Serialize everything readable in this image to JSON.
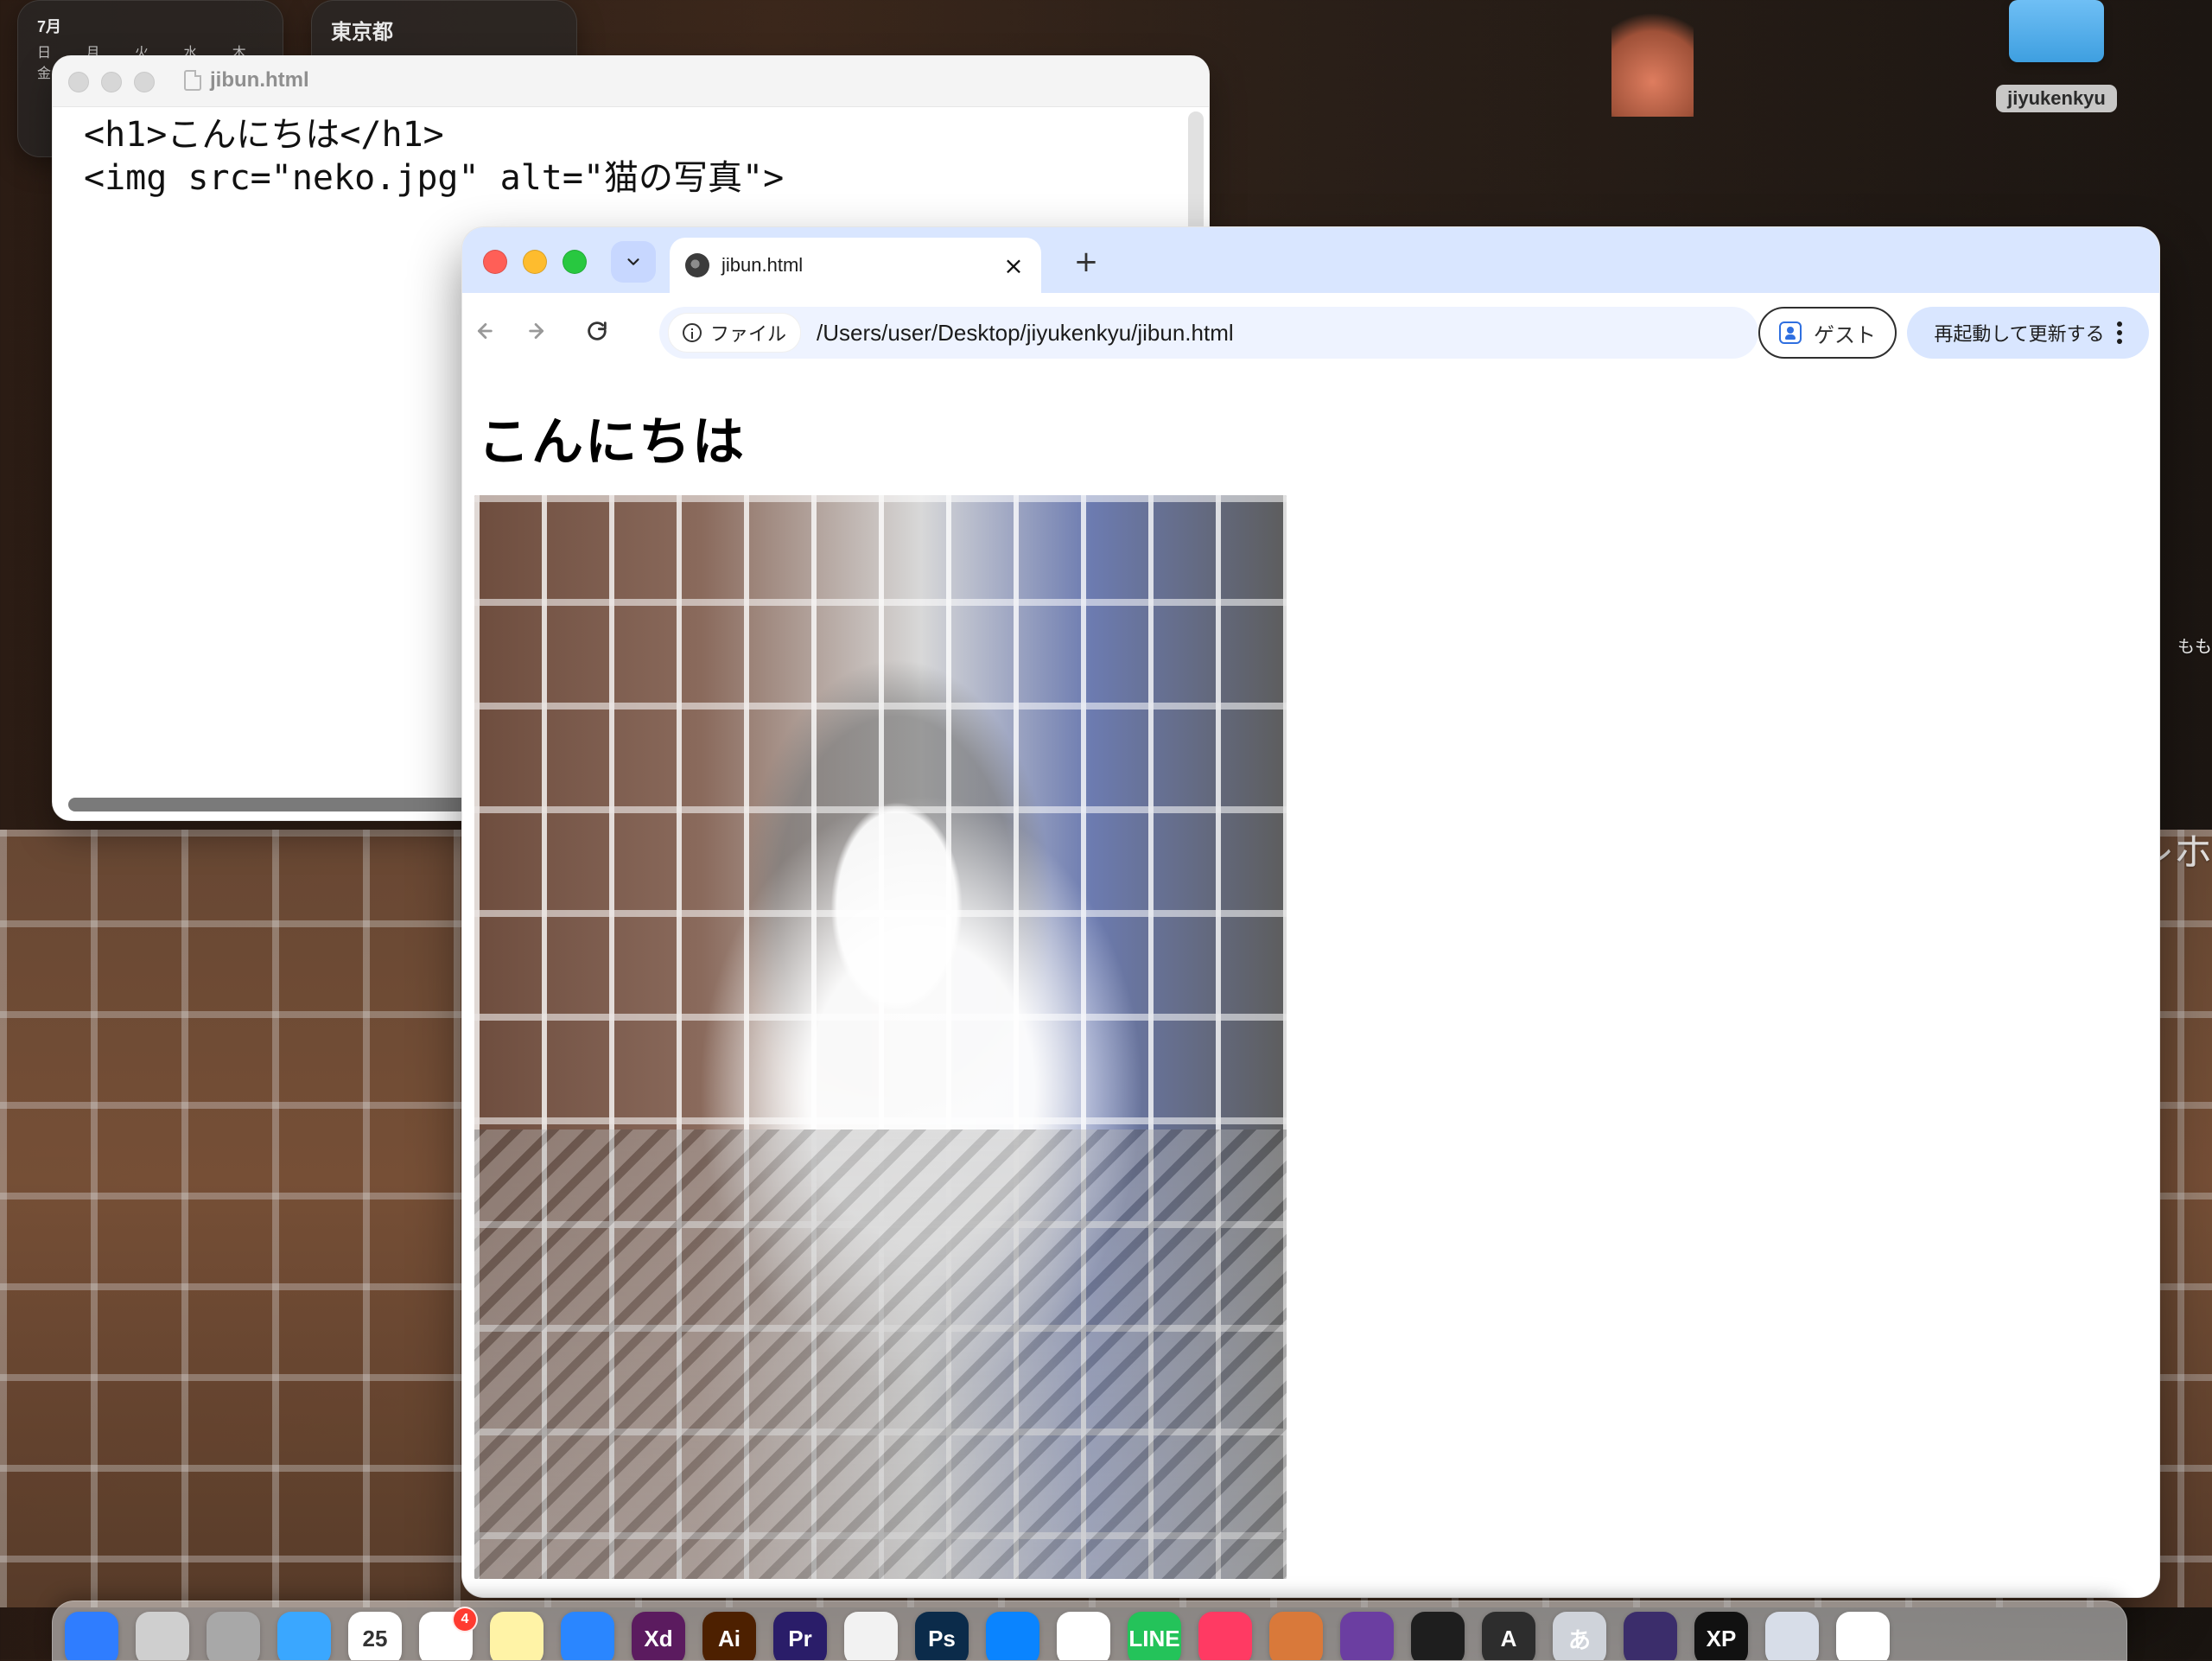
{
  "desktop": {
    "widgets": [
      {
        "title": "7月",
        "subtitle": "日 月 火 水 木 金 土"
      },
      {
        "title": "東京都",
        "subtitle": ""
      }
    ],
    "folder_label": "jiyukenkyu",
    "right_snippets": [
      "もも",
      "レホ"
    ]
  },
  "editor": {
    "title": "jibun.html",
    "lines": [
      "<h1>こんにちは</h1>",
      "<img src=\"neko.jpg\" alt=\"猫の写真\">"
    ]
  },
  "browser": {
    "tab_title": "jibun.html",
    "new_tab_symbol": "+",
    "tab_close_symbol": "×",
    "omnibox": {
      "chip_label": "ファイル",
      "url": "/Users/user/Desktop/jiyukenkyu/jibun.html"
    },
    "guest_label": "ゲスト",
    "update_label": "再起動して更新する",
    "page": {
      "h1": "こんにちは",
      "image_alt": "猫の写真"
    }
  },
  "dock": {
    "apps": [
      {
        "name": "Finder",
        "color": "#2f7dff",
        "label": ""
      },
      {
        "name": "Launchpad",
        "color": "#cfcfcf",
        "label": ""
      },
      {
        "name": "Settings",
        "color": "#a8a8a8",
        "label": ""
      },
      {
        "name": "Mail",
        "color": "#3aa7ff",
        "label": ""
      },
      {
        "name": "Calendar",
        "color": "#ffffff",
        "label": "25"
      },
      {
        "name": "Reminders",
        "color": "#ffffff",
        "label": "",
        "badge": "4"
      },
      {
        "name": "Notes",
        "color": "#fff3a6",
        "label": ""
      },
      {
        "name": "App Store",
        "color": "#2a86ff",
        "label": ""
      },
      {
        "name": "Adobe XD",
        "color": "#5b1b5f",
        "label": "Xd"
      },
      {
        "name": "Illustrator",
        "color": "#4d2000",
        "label": "Ai"
      },
      {
        "name": "Premiere",
        "color": "#2a1d69",
        "label": "Pr"
      },
      {
        "name": "Chrome",
        "color": "#f2f2f2",
        "label": ""
      },
      {
        "name": "Photoshop",
        "color": "#0b2b4a",
        "label": "Ps"
      },
      {
        "name": "VS Code",
        "color": "#0a84ff",
        "label": ""
      },
      {
        "name": "Slack",
        "color": "#ffffff",
        "label": ""
      },
      {
        "name": "LINE",
        "color": "#24c35a",
        "label": "LINE"
      },
      {
        "name": "Creative Cloud",
        "color": "#ff3a63",
        "label": ""
      },
      {
        "name": "Claude",
        "color": "#d9793a",
        "label": ""
      },
      {
        "name": "GitHub Desktop",
        "color": "#6b3ea1",
        "label": ""
      },
      {
        "name": "Figma",
        "color": "#1e1e1e",
        "label": ""
      },
      {
        "name": "Aspect",
        "color": "#2d2d2d",
        "label": "A"
      },
      {
        "name": "Input",
        "color": "#cfd3da",
        "label": "あ"
      },
      {
        "name": "Obsidian",
        "color": "#3b2d6b",
        "label": ""
      },
      {
        "name": "XPPen",
        "color": "#111111",
        "label": "XP"
      },
      {
        "name": "Bot",
        "color": "#d7dde8",
        "label": ""
      },
      {
        "name": "Notebook",
        "color": "#ffffff",
        "label": ""
      }
    ]
  }
}
